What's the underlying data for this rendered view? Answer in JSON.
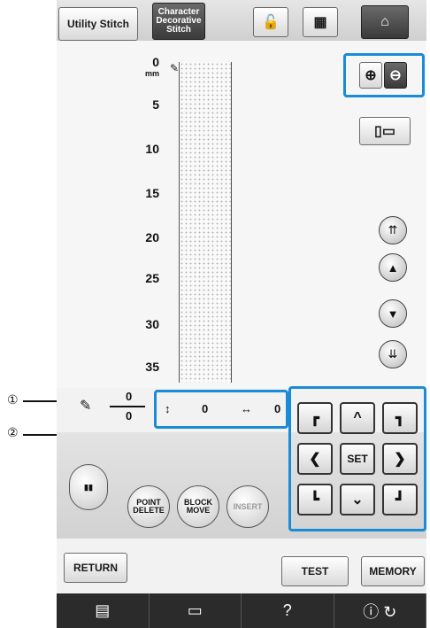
{
  "tabs": {
    "utility": "Utility Stitch",
    "character": [
      "Character",
      "Decorative",
      "Stitch"
    ]
  },
  "ruler": {
    "unit": "mm",
    "ticks": [
      "0",
      "5",
      "10",
      "15",
      "20",
      "25",
      "30",
      "35"
    ]
  },
  "readout": {
    "top": "0",
    "bottom": "0",
    "vertical": "0",
    "horizontal": "0"
  },
  "callouts": [
    "①",
    "②"
  ],
  "edit": {
    "point_delete": [
      "POINT",
      "DELETE"
    ],
    "block_move": [
      "BLOCK",
      "MOVE"
    ],
    "insert": "INSERT"
  },
  "nav": {
    "set": "SET"
  },
  "actions": {
    "return": "RETURN",
    "test": "TEST",
    "memory": "MEMORY"
  },
  "status": {
    "help": "?"
  },
  "colors": {
    "highlight": "#1a8bd6"
  }
}
